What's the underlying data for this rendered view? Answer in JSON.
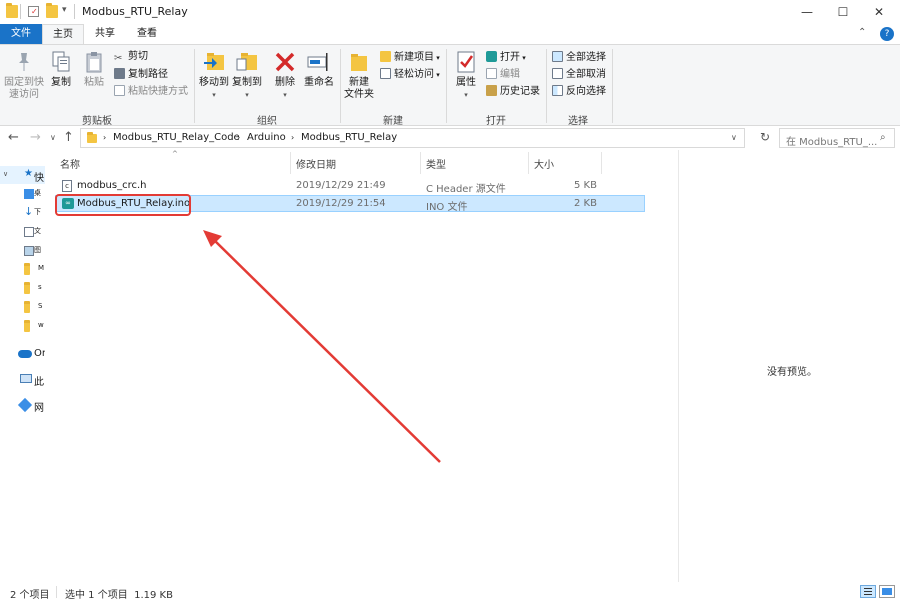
{
  "window": {
    "title": "Modbus_RTU_Relay",
    "minimize": "—",
    "maximize": "☐",
    "close": "✕",
    "help": "?",
    "collapse": "⌃"
  },
  "ribbon": {
    "tabs": [
      "文件",
      "主页",
      "共享",
      "查看"
    ],
    "clipboard": {
      "pin_label": "固定到快\n速访问",
      "copy_label": "复制",
      "paste_label": "粘贴",
      "cut_label": "剪切",
      "copy_path_label": "复制路径",
      "paste_shortcut_label": "粘贴快捷方式",
      "group_label": "剪贴板"
    },
    "organize": {
      "move_to_label": "移动到",
      "copy_to_label": "复制到",
      "delete_label": "删除",
      "rename_label": "重命名",
      "group_label": "组织"
    },
    "new": {
      "new_folder_label": "新建\n文件夹",
      "new_item_label": "新建项目",
      "easy_access_label": "轻松访问",
      "group_label": "新建"
    },
    "open": {
      "properties_label": "属性",
      "open_label": "打开",
      "edit_label": "编辑",
      "history_label": "历史记录",
      "group_label": "打开"
    },
    "select": {
      "select_all_label": "全部选择",
      "select_none_label": "全部取消",
      "invert_label": "反向选择",
      "group_label": "选择"
    }
  },
  "address": {
    "crumbs": [
      "Modbus_RTU_Relay_Code",
      "Arduino",
      "Modbus_RTU_Relay"
    ],
    "search_placeholder": "在 Modbus_RTU_..."
  },
  "nav_pane": {
    "items": [
      {
        "label": "快"
      },
      {
        "label": "桌"
      },
      {
        "label": "下"
      },
      {
        "label": "文"
      },
      {
        "label": "图"
      },
      {
        "label": "M"
      },
      {
        "label": "s"
      },
      {
        "label": "S"
      },
      {
        "label": "w"
      },
      {
        "label": "On"
      },
      {
        "label": "此"
      },
      {
        "label": "网"
      }
    ]
  },
  "file_list": {
    "columns": [
      "名称",
      "修改日期",
      "类型",
      "大小"
    ],
    "rows": [
      {
        "name": "modbus_crc.h",
        "date": "2019/12/29 21:49",
        "type": "C Header 源文件",
        "size": "5 KB"
      },
      {
        "name": "Modbus_RTU_Relay.ino",
        "date": "2019/12/29 21:54",
        "type": "INO 文件",
        "size": "2 KB"
      }
    ]
  },
  "preview": {
    "text": "没有预览。"
  },
  "status": {
    "count": "2 个项目",
    "selection": "选中 1 个项目  1.19 KB"
  },
  "colors": {
    "file_tab": "#1a73c8",
    "selection_bg": "#cce8ff",
    "annotation": "#e33b35"
  }
}
